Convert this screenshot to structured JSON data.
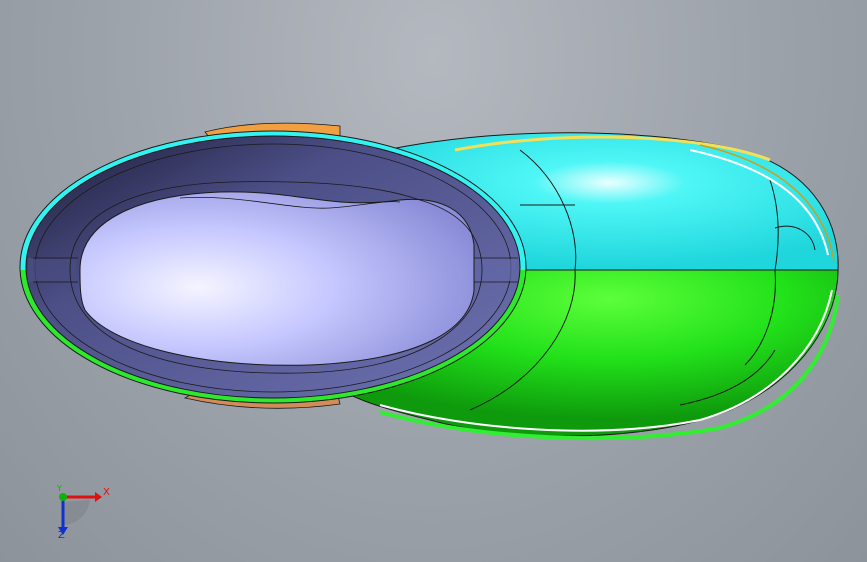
{
  "viewport": {
    "background": "#9ca2aa"
  },
  "colors": {
    "top_half": "#35f2f2",
    "bottom_half": "#2ee82e",
    "collar_inner": "#55588e",
    "opening": "#c3c6ff",
    "heel_accent": "#f0a040",
    "outline": "#1a1a1a"
  },
  "triad": {
    "x_label": "X",
    "y_label": "Y",
    "z_label": "Z",
    "x_color": "#e01010",
    "y_color": "#10b010",
    "z_color": "#1030d0"
  }
}
